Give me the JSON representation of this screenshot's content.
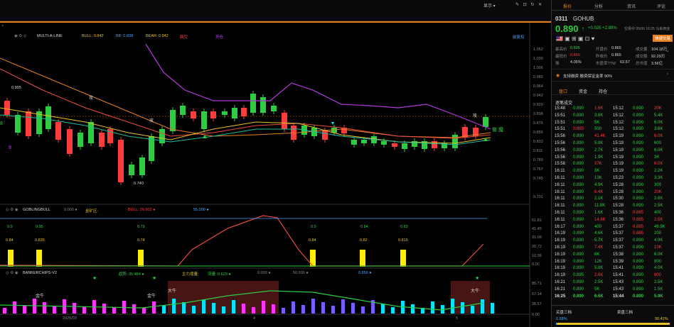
{
  "topbar": {
    "btn_show": "显示 ▾",
    "btn_icons": "✎ ⊡ ↻ ✕"
  },
  "toolbar": {
    "multi_line": "MULTI-A-LINE",
    "bull": "BULL: 0.842",
    "bb": "BB: 0.838",
    "bear": "BEAR: 0.842",
    "extra1": "跨空",
    "extra2": "开仓",
    "restore": "前复权"
  },
  "main_chart": {
    "labels": [
      {
        "t": "攻",
        "c": "#ddd"
      },
      {
        "t": "攻",
        "c": "#ddd"
      },
      {
        "t": "攻",
        "c": "#ddd"
      },
      {
        "t": "攻",
        "c": "#ddd"
      },
      {
        "t": "做 魔",
        "c": "#2ecc40"
      },
      {
        "t": "0.905",
        "c": "#ddd"
      },
      {
        "t": "0.740",
        "c": "#ddd"
      },
      {
        "t": "9",
        "c": "#cc44ff"
      },
      {
        "t": "8",
        "c": "#2ecc40"
      }
    ],
    "yaxis": [
      "1.052",
      "1.030",
      "1.006",
      "0.985",
      "0.964",
      "0.942",
      "0.920",
      "0.898",
      "0.876",
      "0.855",
      "0.833",
      "0.811",
      "0.789",
      "0.767",
      "0.745",
      "0.701"
    ]
  },
  "panel2": {
    "name": "GOBLINGBULL",
    "v0": "0.000 ●",
    "v1": "金矿区:",
    "v2": "BULL: 26.902 ●",
    "v3": "55.000 ●",
    "labels_green": [
      "0.9",
      "0.95",
      "0.79",
      "0.9",
      "0.84",
      "0.83"
    ],
    "labels_yellow": [
      "0.84",
      "0.835",
      "0.74",
      "0.84",
      "0.82",
      "0.815"
    ],
    "yaxis": [
      "51.81",
      "41.45",
      "31.09",
      "20.72",
      "10.36",
      "0.00"
    ]
  },
  "panel3": {
    "name": "BANKERCHIPS-V2",
    "v1": "趋势: 35.484 ●",
    "v2": "主力增量:",
    "v3": "流量: 0.629 ●",
    "v4": "0.000 ●",
    "v5": "50.000 ●",
    "v6": "0.856 ●",
    "tags": [
      "金牛",
      "金牛",
      "大牛",
      "大牛"
    ],
    "yaxis": [
      "85.71",
      "57.14",
      "28.57",
      "0.00"
    ]
  },
  "xaxis": [
    "2025/03",
    "4",
    "5"
  ],
  "right": {
    "tabs": [
      "报价",
      "分析",
      "资讯",
      "评论"
    ],
    "code": "0311",
    "name": "GOHUB",
    "price": "0.890",
    "arrow": "↑",
    "change": "+0.025 +2.89%",
    "time": "交易中 05/06 16:25 马来西亚",
    "btn": "快捷交易",
    "high_l": "最高价",
    "high_v": "0.895",
    "open_l": "开盘价",
    "open_v": "0.865",
    "vol_l": "成交量",
    "vol_v": "104.18万",
    "low_l": "最低价",
    "low_v": "0.860",
    "prev_l": "昨收价",
    "prev_v": "0.865",
    "amt_l": "成交额",
    "amt_v": "92.29万",
    "amp_l": "振",
    "amp_v": "4.05%",
    "pe_l": "市盈率TTM",
    "pe_v": "63.57",
    "cap_l": "总市值",
    "cap_v": "3.56亿",
    "margin": "支持融资 融资保证金率 90%",
    "subtabs": [
      "盘口",
      "资金",
      "持仓"
    ],
    "trades_title": "逐笔成交",
    "bottom_l": "买盘三档",
    "bottom_r": "卖盘三档",
    "pct_l": "0.58%",
    "pct_r": "90.42%"
  },
  "trades": [
    [
      "15:48",
      "0.890",
      "1.6K",
      "15:12",
      "0.890",
      "20K"
    ],
    [
      "15:51",
      "0.890",
      "3.6K",
      "15:12",
      "0.890",
      "5.4K"
    ],
    [
      "15:51",
      "0.890",
      "5K",
      "15:12",
      "0.890",
      "6.0K"
    ],
    [
      "15:51",
      "0.885",
      "500",
      "15:12",
      "0.890",
      "3.6K"
    ],
    [
      "15:56",
      "0.890",
      "41.4K",
      "15:19",
      "0.890",
      "6.0K"
    ],
    [
      "15:56",
      "0.890",
      "5.9K",
      "15:19",
      "0.890",
      "600"
    ],
    [
      "15:56",
      "0.890",
      "2.7K",
      "15:19",
      "0.890",
      "6.0K"
    ],
    [
      "15:56",
      "0.890",
      "1.9K",
      "15:19",
      "0.890",
      "3K"
    ],
    [
      "15:58",
      "0.890",
      "37K",
      "15:19",
      "0.890",
      "6.0K"
    ],
    [
      "16:11",
      "0.890",
      "3K",
      "15:19",
      "0.890",
      "2.2K"
    ],
    [
      "16:11",
      "0.890",
      "13K",
      "15:23",
      "0.890",
      "3.3K"
    ],
    [
      "16:11",
      "0.890",
      "4.9K",
      "15:28",
      "0.890",
      "300"
    ],
    [
      "16:11",
      "0.890",
      "6.4K",
      "15:28",
      "0.890",
      "20K"
    ],
    [
      "16:11",
      "0.890",
      "2.1K",
      "15:30",
      "0.890",
      "3.6K"
    ],
    [
      "16:11",
      "0.890",
      "11.8K",
      "15:28",
      "0.890",
      "2.5K"
    ],
    [
      "16:11",
      "0.890",
      "1.6K",
      "15:36",
      "0.885",
      "400"
    ],
    [
      "16:11",
      "0.890",
      "14.8K",
      "15:36",
      "0.885",
      "2.5K"
    ],
    [
      "16:17",
      "0.890",
      "400",
      "15:37",
      "0.885",
      "46.9K"
    ],
    [
      "16:19",
      "0.890",
      "4.6K",
      "15:37",
      "0.885",
      "200"
    ],
    [
      "16:19",
      "0.890",
      "5.7K",
      "15:37",
      "0.890",
      "4.9K"
    ],
    [
      "16:19",
      "0.890",
      "7.4K",
      "15:37",
      "0.890",
      "10K"
    ],
    [
      "16:19",
      "0.890",
      "6K",
      "15:38",
      "0.890",
      "6.0K"
    ],
    [
      "16:19",
      "0.890",
      "12K",
      "15:39",
      "0.890",
      "800"
    ],
    [
      "16:19",
      "0.890",
      "5.8K",
      "15:41",
      "0.890",
      "4.0K"
    ],
    [
      "16:19",
      "0.895",
      "2.6K",
      "15:41",
      "0.890",
      "800"
    ],
    [
      "16:21",
      "0.890",
      "2.5K",
      "15:43",
      "0.890",
      "2.5K"
    ],
    [
      "16:21",
      "0.890",
      "5K",
      "15:43",
      "0.890",
      "1.5K"
    ],
    [
      "16:25",
      "0.890",
      "6.6K",
      "15:44",
      "0.890",
      "5.9K"
    ]
  ]
}
